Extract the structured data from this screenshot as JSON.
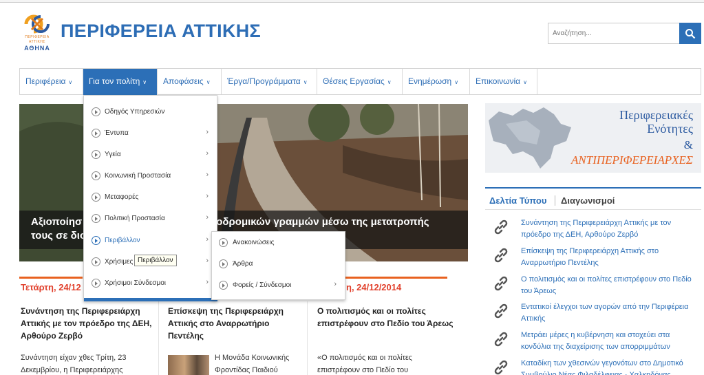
{
  "header": {
    "logo_text_1": "ΠΕΡΙΦΕΡΕΙΑ",
    "logo_text_2": "ΑΤΤΙΚΗΣ",
    "logo_text_3": "ΑΘΗΝΑ",
    "site_title": "ΠΕΡΙΦΕΡΕΙΑ ΑΤΤΙΚΗΣ",
    "search_placeholder": "Αναζήτηση..."
  },
  "nav": {
    "items": [
      {
        "label": "Περιφέρεια",
        "active": false
      },
      {
        "label": "Για τον πολίτη",
        "active": true
      },
      {
        "label": "Αποφάσεις",
        "active": false
      },
      {
        "label": "Έργα/Προγράμματα",
        "active": false
      },
      {
        "label": "Θέσεις Εργασίας",
        "active": false
      },
      {
        "label": "Ενημέρωση",
        "active": false
      },
      {
        "label": "Επικοινωνία",
        "active": false
      }
    ]
  },
  "dropdown": {
    "items": [
      {
        "label": "Οδηγός Υπηρεσιών",
        "has_submenu": false
      },
      {
        "label": "Έντυπα",
        "has_submenu": true
      },
      {
        "label": "Υγεία",
        "has_submenu": true
      },
      {
        "label": "Κοινωνική Προστασία",
        "has_submenu": true
      },
      {
        "label": "Μεταφορές",
        "has_submenu": true
      },
      {
        "label": "Πολιτική Προστασία",
        "has_submenu": true
      },
      {
        "label": "Περιβάλλον",
        "has_submenu": true
      },
      {
        "label": "Χρήσιμες",
        "has_submenu": true
      },
      {
        "label": "Χρήσιμοι Σύνδεσμοι",
        "has_submenu": true
      }
    ],
    "tooltip": "Περιβάλλον"
  },
  "subdropdown": {
    "items": [
      {
        "label": "Ανακοινώσεις",
        "has_submenu": false
      },
      {
        "label": "Άρθρα",
        "has_submenu": false
      },
      {
        "label": "Φορείς / Σύνδεσμοι",
        "has_submenu": true
      }
    ]
  },
  "slider": {
    "caption_line1_left": "Αξιοποίησ",
    "caption_line1_right": "οδρομικών γραμμών μέσω της μετατροπής",
    "caption_line2": "τους σε διο"
  },
  "news": {
    "col1": {
      "date": "Τετάρτη, 24/12",
      "title": [
        "Συνάντηση της Περιφερειάρχη",
        "Αττικής με τον πρόεδρο της ΔΕΗ,",
        "Αρθούρο Ζερβό"
      ],
      "text": [
        "Συνάντηση είχαν χθες Τρίτη, 23",
        "Δεκεμβρίου, η Περιφερειάρχης"
      ]
    },
    "col2": {
      "title": [
        "Επίσκεψη της Περιφερειάρχη",
        "Αττικής στο Αναρρωτήριο",
        "Πεντέλης"
      ],
      "text": [
        "Η Μονάδα Κοινωνικής",
        "Φροντίδας Παιδιού"
      ]
    },
    "col3": {
      "date": "η, 24/12/2014",
      "title": [
        "Ο πολιτισμός και οι πολίτες",
        "επιστρέφουν στο Πεδίο του Άρεως"
      ],
      "text": [
        "«Ο πολιτισμός και οι πολίτες",
        "επιστρέφουν στο Πεδίο του"
      ]
    }
  },
  "sidebar": {
    "banner": {
      "line1": "Περιφερειακές",
      "line2": "Ενότητες",
      "line3": "&",
      "line4": "ΑΝΤΙΠΕΡΙΦΕΡΕΙΑΡΧΕΣ"
    },
    "tabs": [
      {
        "label": "Δελτία Τύπου",
        "active": true
      },
      {
        "label": "Διαγωνισμοί",
        "active": false
      }
    ],
    "press_releases": [
      [
        "Συνάντηση της Περιφερειάρχη Αττικής με τον",
        "πρόεδρο της ΔΕΗ, Αρθούρο Ζερβό"
      ],
      [
        "Επίσκεψη της Περιφερειάρχη Αττικής στο",
        "Αναρρωτήριο Πεντέλης"
      ],
      [
        "Ο πολιτισμός και οι πολίτες επιστρέφουν στο Πεδίο",
        "του Άρεως"
      ],
      [
        "Εντατικοί έλεγχοι των αγορών από την Περιφέρεια",
        "Αττικής"
      ],
      [
        "Μετράει μέρες η κυβέρνηση και στοχεύει στα",
        "κονδύλια της διαχείρισης των απορριμμάτων"
      ],
      [
        "Καταδίκη των χθεσινών γεγονότων στο Δημοτικό",
        "Συμβούλιο Νέας Φιλαδέλφειας - Χαλκηδόνας"
      ]
    ]
  },
  "colors": {
    "brand_blue": "#2c6fb7",
    "accent_orange": "#e8611f",
    "date_red": "#e1402c"
  }
}
